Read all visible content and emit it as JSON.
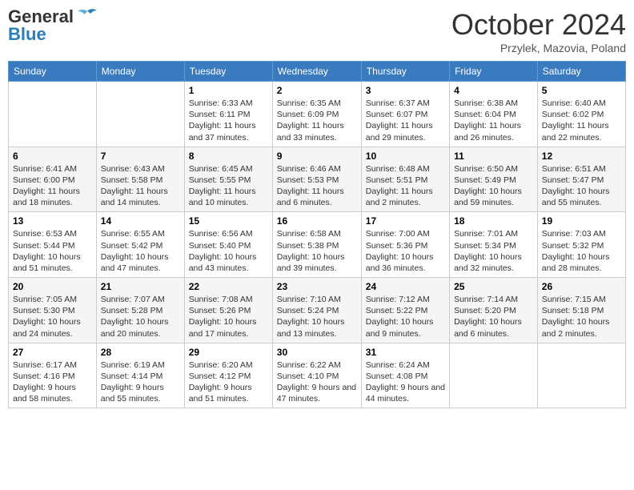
{
  "header": {
    "logo_line1": "General",
    "logo_line2": "Blue",
    "month": "October 2024",
    "location": "Przylek, Mazovia, Poland"
  },
  "weekdays": [
    "Sunday",
    "Monday",
    "Tuesday",
    "Wednesday",
    "Thursday",
    "Friday",
    "Saturday"
  ],
  "weeks": [
    [
      {
        "day": "",
        "text": ""
      },
      {
        "day": "",
        "text": ""
      },
      {
        "day": "1",
        "text": "Sunrise: 6:33 AM\nSunset: 6:11 PM\nDaylight: 11 hours and 37 minutes."
      },
      {
        "day": "2",
        "text": "Sunrise: 6:35 AM\nSunset: 6:09 PM\nDaylight: 11 hours and 33 minutes."
      },
      {
        "day": "3",
        "text": "Sunrise: 6:37 AM\nSunset: 6:07 PM\nDaylight: 11 hours and 29 minutes."
      },
      {
        "day": "4",
        "text": "Sunrise: 6:38 AM\nSunset: 6:04 PM\nDaylight: 11 hours and 26 minutes."
      },
      {
        "day": "5",
        "text": "Sunrise: 6:40 AM\nSunset: 6:02 PM\nDaylight: 11 hours and 22 minutes."
      }
    ],
    [
      {
        "day": "6",
        "text": "Sunrise: 6:41 AM\nSunset: 6:00 PM\nDaylight: 11 hours and 18 minutes."
      },
      {
        "day": "7",
        "text": "Sunrise: 6:43 AM\nSunset: 5:58 PM\nDaylight: 11 hours and 14 minutes."
      },
      {
        "day": "8",
        "text": "Sunrise: 6:45 AM\nSunset: 5:55 PM\nDaylight: 11 hours and 10 minutes."
      },
      {
        "day": "9",
        "text": "Sunrise: 6:46 AM\nSunset: 5:53 PM\nDaylight: 11 hours and 6 minutes."
      },
      {
        "day": "10",
        "text": "Sunrise: 6:48 AM\nSunset: 5:51 PM\nDaylight: 11 hours and 2 minutes."
      },
      {
        "day": "11",
        "text": "Sunrise: 6:50 AM\nSunset: 5:49 PM\nDaylight: 10 hours and 59 minutes."
      },
      {
        "day": "12",
        "text": "Sunrise: 6:51 AM\nSunset: 5:47 PM\nDaylight: 10 hours and 55 minutes."
      }
    ],
    [
      {
        "day": "13",
        "text": "Sunrise: 6:53 AM\nSunset: 5:44 PM\nDaylight: 10 hours and 51 minutes."
      },
      {
        "day": "14",
        "text": "Sunrise: 6:55 AM\nSunset: 5:42 PM\nDaylight: 10 hours and 47 minutes."
      },
      {
        "day": "15",
        "text": "Sunrise: 6:56 AM\nSunset: 5:40 PM\nDaylight: 10 hours and 43 minutes."
      },
      {
        "day": "16",
        "text": "Sunrise: 6:58 AM\nSunset: 5:38 PM\nDaylight: 10 hours and 39 minutes."
      },
      {
        "day": "17",
        "text": "Sunrise: 7:00 AM\nSunset: 5:36 PM\nDaylight: 10 hours and 36 minutes."
      },
      {
        "day": "18",
        "text": "Sunrise: 7:01 AM\nSunset: 5:34 PM\nDaylight: 10 hours and 32 minutes."
      },
      {
        "day": "19",
        "text": "Sunrise: 7:03 AM\nSunset: 5:32 PM\nDaylight: 10 hours and 28 minutes."
      }
    ],
    [
      {
        "day": "20",
        "text": "Sunrise: 7:05 AM\nSunset: 5:30 PM\nDaylight: 10 hours and 24 minutes."
      },
      {
        "day": "21",
        "text": "Sunrise: 7:07 AM\nSunset: 5:28 PM\nDaylight: 10 hours and 20 minutes."
      },
      {
        "day": "22",
        "text": "Sunrise: 7:08 AM\nSunset: 5:26 PM\nDaylight: 10 hours and 17 minutes."
      },
      {
        "day": "23",
        "text": "Sunrise: 7:10 AM\nSunset: 5:24 PM\nDaylight: 10 hours and 13 minutes."
      },
      {
        "day": "24",
        "text": "Sunrise: 7:12 AM\nSunset: 5:22 PM\nDaylight: 10 hours and 9 minutes."
      },
      {
        "day": "25",
        "text": "Sunrise: 7:14 AM\nSunset: 5:20 PM\nDaylight: 10 hours and 6 minutes."
      },
      {
        "day": "26",
        "text": "Sunrise: 7:15 AM\nSunset: 5:18 PM\nDaylight: 10 hours and 2 minutes."
      }
    ],
    [
      {
        "day": "27",
        "text": "Sunrise: 6:17 AM\nSunset: 4:16 PM\nDaylight: 9 hours and 58 minutes."
      },
      {
        "day": "28",
        "text": "Sunrise: 6:19 AM\nSunset: 4:14 PM\nDaylight: 9 hours and 55 minutes."
      },
      {
        "day": "29",
        "text": "Sunrise: 6:20 AM\nSunset: 4:12 PM\nDaylight: 9 hours and 51 minutes."
      },
      {
        "day": "30",
        "text": "Sunrise: 6:22 AM\nSunset: 4:10 PM\nDaylight: 9 hours and 47 minutes."
      },
      {
        "day": "31",
        "text": "Sunrise: 6:24 AM\nSunset: 4:08 PM\nDaylight: 9 hours and 44 minutes."
      },
      {
        "day": "",
        "text": ""
      },
      {
        "day": "",
        "text": ""
      }
    ]
  ]
}
